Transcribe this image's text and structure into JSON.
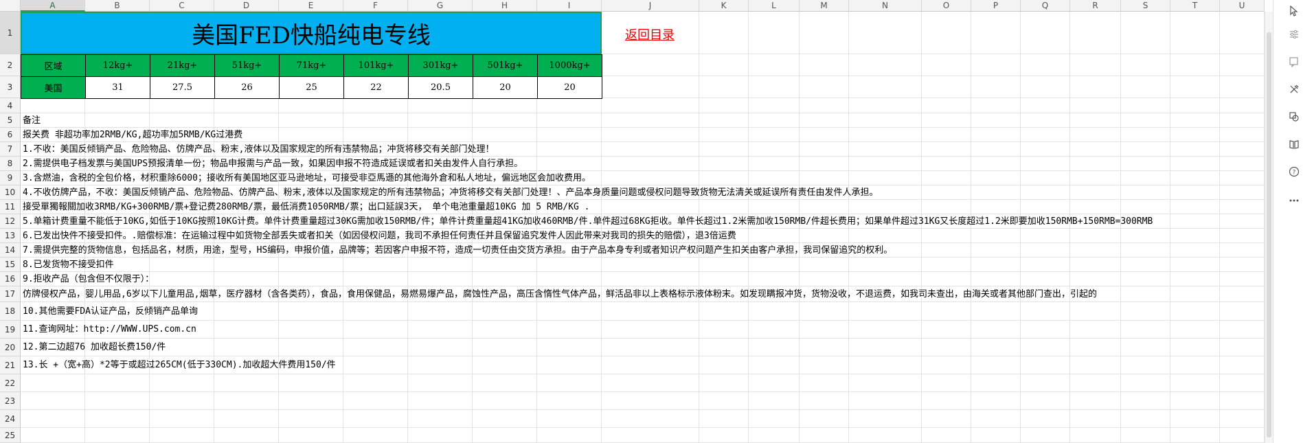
{
  "columns": [
    "A",
    "B",
    "C",
    "D",
    "E",
    "F",
    "G",
    "H",
    "I",
    "J",
    "K",
    "L",
    "M",
    "N",
    "O",
    "P",
    "Q",
    "R",
    "S",
    "T",
    "U"
  ],
  "rows": [
    "1",
    "2",
    "3",
    "4",
    "5",
    "6",
    "7",
    "8",
    "9",
    "10",
    "11",
    "12",
    "13",
    "14",
    "15",
    "16",
    "17",
    "18",
    "19",
    "20",
    "21",
    "22",
    "23",
    "24",
    "25"
  ],
  "title": "美国FED快船纯电专线",
  "back_link": "返回目录",
  "table": {
    "header": [
      "区域",
      "12kg+",
      "21kg+",
      "51kg+",
      "71kg+",
      "101kg+",
      "301kg+",
      "501kg+",
      "1000kg+"
    ],
    "row": [
      "美国",
      "31",
      "27.5",
      "26",
      "25",
      "22",
      "20.5",
      "20",
      "20"
    ]
  },
  "notes": [
    "备注",
    "报关费 非超功率加2RMB/KG,超功率加5RMB/KG过港费",
    "1.不收：美国反倾销产品、危险物品、仿牌产品、粉末,液体以及国家规定的所有违禁物品；冲货将移交有关部门处理！",
    "2.需提供电子档发票与美国UPS预报清单一份；物品申报需与产品一致，如果因申报不符造成延误或者扣关由发件人自行承担。",
    "3.含燃油，含税的全包价格，材积重除6000；接收所有美国地区亚马逊地址，可接受非亞馬遜的其他海外倉和私人地址，偏远地区会加收费用。",
    "4.不收仿牌产品，不收：美国反倾销产品、危险物品、仿牌产品、粉末,液体以及国家规定的所有违禁物品；冲货将移交有关部门处理！、产品本身质量问题或侵权问题导致货物无法清关或延误所有责任由发件人承担。",
    "接受單獨報關加收3RMB/KG+300RMB/票+登记费280RMB/票，最低消费1050RMB/票；出口延誤3天， 单个电池重量超10KG  加 5 RMB/KG .",
    "5.单箱计费重量不能低于10KG,如低于10KG按照10KG计费。单件计费重量超过30KG需加收150RMB/件；单件计费重量超41KG加收460RMB/件.单件超过68KG拒收。单件长超过1.2米需加收150RMB/件超长费用；如果单件超过31KG又长度超过1.2米即要加收150RMB+150RMB=300RMB",
    "6.已发出快件不接受扣件。.赔偿标准：在运输过程中如货物全部丢失或者扣关（如因侵权问题，我司不承担任何责任并且保留追究发件人因此带来对我司的损失的赔偿），退3倍运费",
    "7.需提供完整的货物信息，包括品名，材质，用途，型号，HS编码，申报价值，品牌等；若因客户申报不符，造成一切责任由交货方承担。由于产品本身专利或者知识产权问题产生扣关由客户承担，我司保留追究的权利。",
    "8.已发货物不接受扣件",
    "9.拒收产品（包含但不仅限于）：",
    "仿牌侵权产品，婴儿用品,6岁以下儿童用品,烟草，医疗器材（含各类药），食品，食用保健品，易燃易爆产品，腐蚀性产品，高压含惰性气体产品，鲜活品非以上表格标示液体粉末。如发现瞒报冲货，货物没收，不退运费，如我司未查出，由海关或者其他部门查出，引起的",
    "10.其他需要FDA认证产品，反倾销产品单询",
    "11.查询网址：http://WWW.UPS.com.cn",
    "12.第二边超76 加收超长费150/件",
    "13.长 +（宽+高）*2等于或超过265CM(低于330CM).加收超大件费用150/件"
  ],
  "colors": {
    "title_bg": "#00b0f0",
    "header_bg": "#00b050",
    "link": "#e00000",
    "selection": "#1e9f5a"
  },
  "sidebar_icons": [
    "cursor-icon",
    "filter-icon",
    "comment-icon",
    "tools-icon",
    "shapes-icon",
    "book-icon",
    "help-icon",
    "more-icon"
  ]
}
